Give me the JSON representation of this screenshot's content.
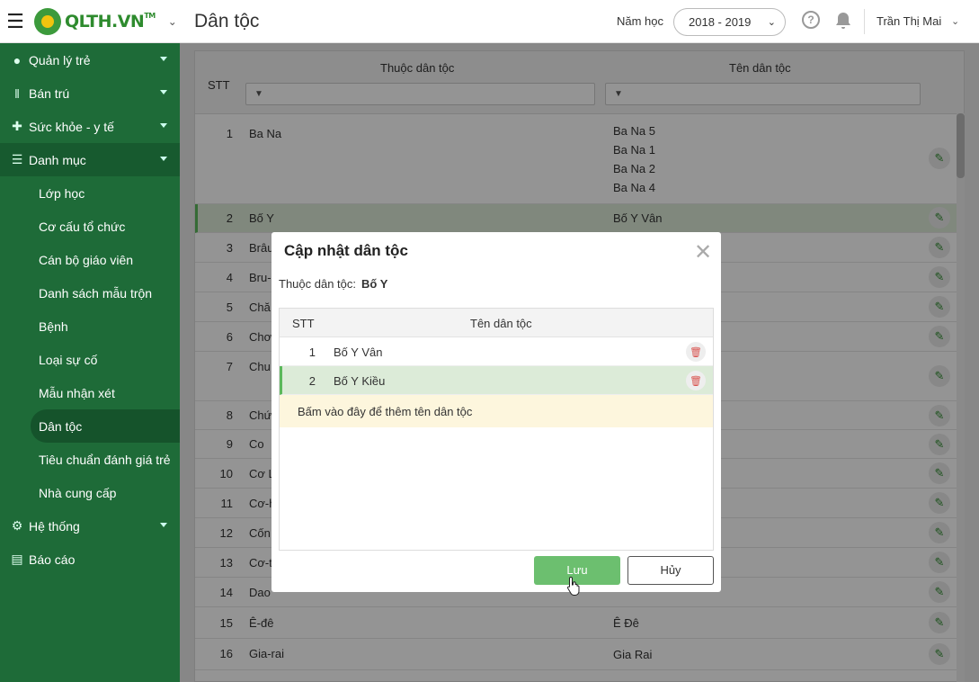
{
  "header": {
    "brand": "QLTH.VN",
    "brand_tm": "TM",
    "page_title": "Dân tộc",
    "year_label": "Năm học",
    "year_value": "2018 - 2019",
    "user_name": "Trần Thị Mai"
  },
  "sidebar": {
    "items": [
      {
        "label": "Quản lý trẻ",
        "icon": "users-icon"
      },
      {
        "label": "Bán trú",
        "icon": "utensils-icon"
      },
      {
        "label": "Sức khỏe - y tế",
        "icon": "medkit-icon"
      },
      {
        "label": "Danh mục",
        "icon": "list-icon"
      }
    ],
    "sub_items": [
      "Lớp học",
      "Cơ cấu tổ chức",
      "Cán bộ giáo viên",
      "Danh sách mẫu trộn",
      "Bệnh",
      "Loại sự cố",
      "Mẫu nhận xét",
      "Dân tộc",
      "Tiêu chuẩn đánh giá trẻ",
      "Nhà cung cấp"
    ],
    "bottom_items": [
      {
        "label": "Hệ thống",
        "icon": "gear-icon"
      },
      {
        "label": "Báo cáo",
        "icon": "report-icon"
      }
    ]
  },
  "table": {
    "columns": {
      "stt": "STT",
      "group": "Thuộc dân tộc",
      "name": "Tên dân tộc"
    },
    "rows": [
      {
        "stt": "1",
        "group": "Ba Na",
        "names": [
          "Ba Na 5",
          "Ba Na 1",
          "Ba Na 2",
          "Ba Na 4"
        ]
      },
      {
        "stt": "2",
        "group": "Bố Y",
        "names": [
          "Bố Y Vân"
        ]
      },
      {
        "stt": "3",
        "group": "Brâu",
        "names": []
      },
      {
        "stt": "4",
        "group": "Bru-",
        "names": []
      },
      {
        "stt": "5",
        "group": "Chă",
        "names": []
      },
      {
        "stt": "6",
        "group": "Chơ",
        "names": []
      },
      {
        "stt": "7",
        "group": "Chu",
        "names": []
      },
      {
        "stt": "8",
        "group": "Chứ",
        "names": []
      },
      {
        "stt": "9",
        "group": "Co",
        "names": []
      },
      {
        "stt": "10",
        "group": "Cơ L",
        "names": []
      },
      {
        "stt": "11",
        "group": "Cơ-h",
        "names": []
      },
      {
        "stt": "12",
        "group": "Cốn",
        "names": []
      },
      {
        "stt": "13",
        "group": "Cơ-t",
        "names": []
      },
      {
        "stt": "14",
        "group": "Dao",
        "names": []
      },
      {
        "stt": "15",
        "group": "Ê-đê",
        "names": [
          "Ê Đê"
        ]
      },
      {
        "stt": "16",
        "group": "Gia-rai",
        "names": [
          "Gia Rai"
        ]
      }
    ]
  },
  "modal": {
    "title": "Cập nhật dân tộc",
    "field_label": "Thuộc dân tộc:",
    "field_value": "Bố Y",
    "grid_header": {
      "stt": "STT",
      "name": "Tên dân tộc"
    },
    "grid_rows": [
      {
        "stt": "1",
        "name": "Bố Y Vân"
      },
      {
        "stt": "2",
        "name": "Bố Y Kiều"
      }
    ],
    "add_hint": "Bấm vào đây để thêm tên dân tộc",
    "save_label": "Lưu",
    "cancel_label": "Hủy"
  }
}
